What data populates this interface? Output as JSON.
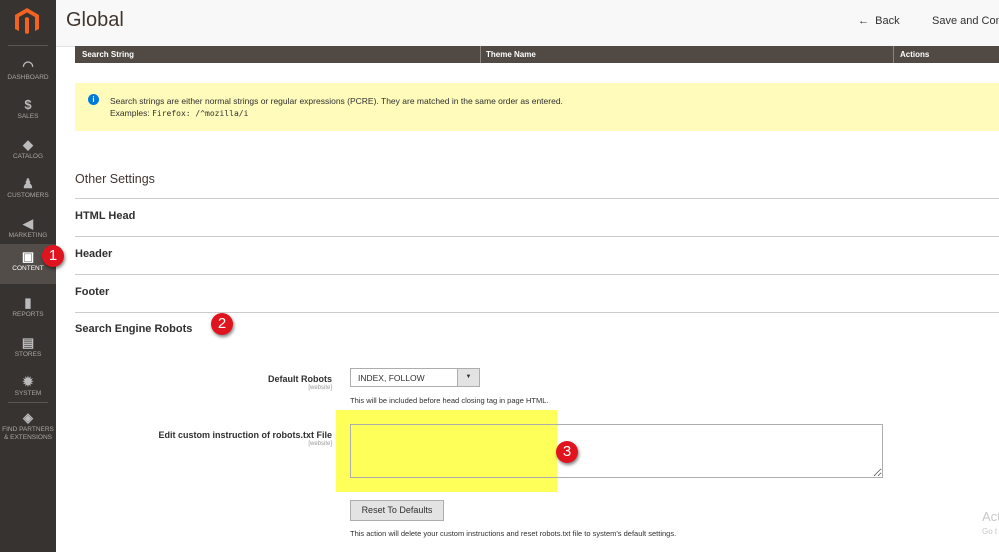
{
  "sidebar": {
    "items": [
      {
        "label": "DASHBOARD",
        "icon": "dashboard-icon"
      },
      {
        "label": "SALES",
        "icon": "dollar-icon"
      },
      {
        "label": "CATALOG",
        "icon": "box-icon"
      },
      {
        "label": "CUSTOMERS",
        "icon": "person-icon"
      },
      {
        "label": "MARKETING",
        "icon": "megaphone-icon"
      },
      {
        "label": "CONTENT",
        "icon": "layout-icon",
        "active": true
      },
      {
        "label": "REPORTS",
        "icon": "bar-chart-icon"
      },
      {
        "label": "STORES",
        "icon": "store-icon"
      },
      {
        "label": "SYSTEM",
        "icon": "gear-icon"
      },
      {
        "label": "FIND PARTNERS & EXTENSIONS",
        "icon": "cube-icon"
      }
    ]
  },
  "header": {
    "title": "Global",
    "back": "Back",
    "save": "Save and Con"
  },
  "table": {
    "columns": [
      "Search String",
      "Theme Name",
      "Actions"
    ]
  },
  "notice": {
    "line1": "Search strings are either normal strings or regular expressions (PCRE). They are matched in the same order as entered.",
    "examples_label": "Examples:",
    "examples_code": "Firefox: /^mozilla/i"
  },
  "sections": {
    "heading": "Other Settings",
    "items": [
      "HTML Head",
      "Header",
      "Footer",
      "Search Engine Robots"
    ]
  },
  "badges": [
    "1",
    "2",
    "3"
  ],
  "form": {
    "default_robots": {
      "label": "Default Robots",
      "scope": "[website]",
      "value": "INDEX, FOLLOW",
      "note": "This will be included before head closing tag in page HTML."
    },
    "custom": {
      "label": "Edit custom instruction of robots.txt File",
      "scope": "[website]",
      "value": ""
    },
    "reset": {
      "label": "Reset To Defaults",
      "note": "This action will delete your custom instructions and reset robots.txt file to system's default settings."
    }
  },
  "watermark": {
    "line1": "Act",
    "line2": "Go t"
  },
  "colors": {
    "sidebar": "#373330",
    "highlight": "#ffff00",
    "badge": "#e0141e",
    "notice": "#fffbbb"
  }
}
